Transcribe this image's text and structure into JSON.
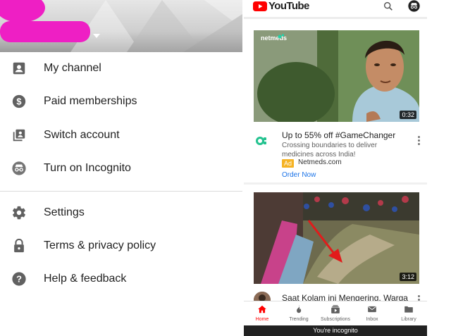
{
  "account_menu": {
    "items": [
      {
        "label": "My channel",
        "icon": "account-box-icon"
      },
      {
        "label": "Paid memberships",
        "icon": "dollar-circle-icon"
      },
      {
        "label": "Switch account",
        "icon": "switch-account-icon"
      },
      {
        "label": "Turn on Incognito",
        "icon": "incognito-icon"
      },
      {
        "label": "Settings",
        "icon": "gear-icon"
      },
      {
        "label": "Terms & privacy policy",
        "icon": "lock-icon"
      },
      {
        "label": "Help & feedback",
        "icon": "help-circle-icon"
      }
    ]
  },
  "youtube": {
    "brand": "YouTube",
    "brand_color": "#ff0000",
    "ad": {
      "badge": "netmeds",
      "duration": "0:32",
      "title": "Up to 55% off #GameChanger",
      "description": "Crossing boundaries to deliver medicines across India!",
      "ad_label": "Ad",
      "domain": "Netmeds.com",
      "cta": "Order Now"
    },
    "video2": {
      "duration": "3:12",
      "title": "Saat Kolam ini Mengering, Warga"
    },
    "bottom_nav": [
      {
        "label": "Home",
        "icon": "home-icon",
        "active": true
      },
      {
        "label": "Trending",
        "icon": "flame-icon",
        "active": false
      },
      {
        "label": "Subscriptions",
        "icon": "subscriptions-icon",
        "active": false
      },
      {
        "label": "Inbox",
        "icon": "inbox-icon",
        "active": false
      },
      {
        "label": "Library",
        "icon": "library-icon",
        "active": false
      }
    ],
    "incognito_bar": "You're incognito"
  }
}
